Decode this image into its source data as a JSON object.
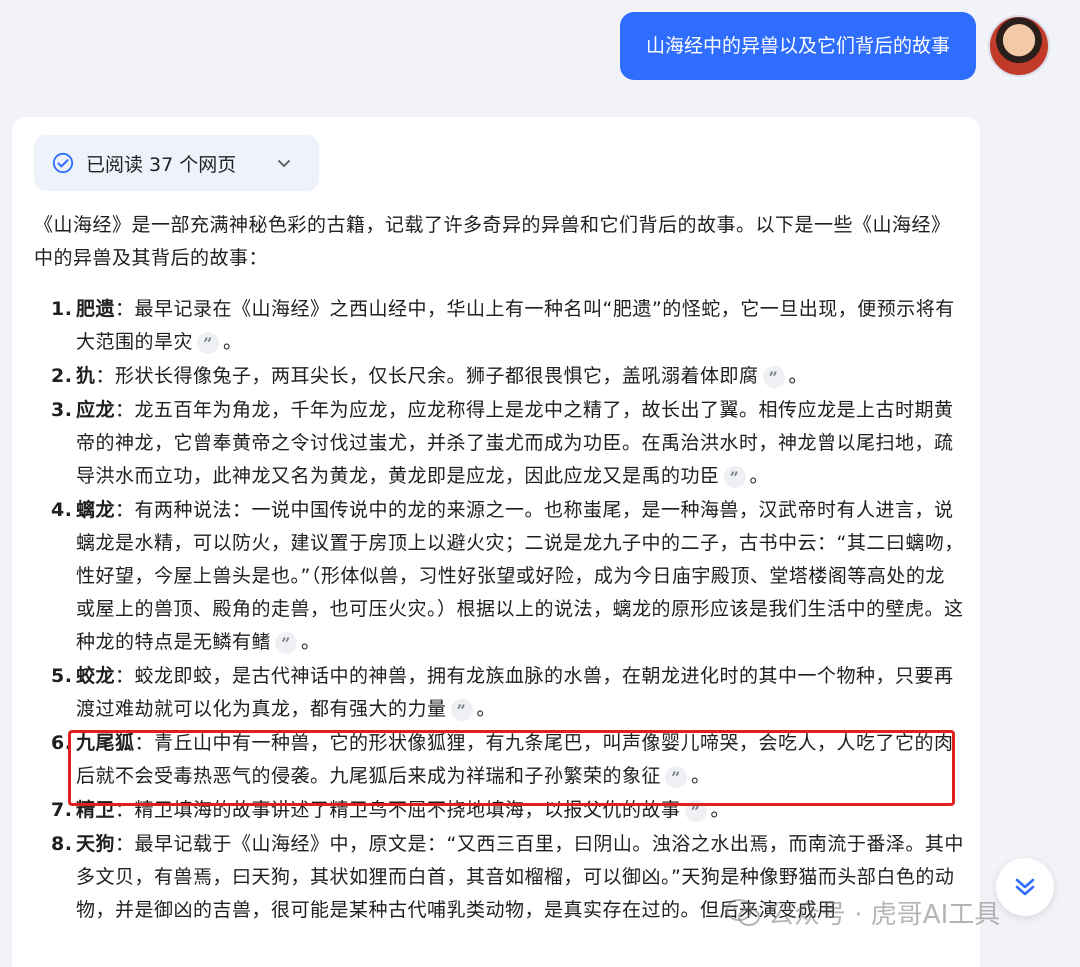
{
  "user": {
    "message": "山海经中的异兽以及它们背后的故事"
  },
  "sources": {
    "label": "已阅读 37 个网页"
  },
  "answer": {
    "intro": "《山海经》是一部充满神秘色彩的古籍，记载了许多奇异的异兽和它们背后的故事。以下是一些《山海经》中的异兽及其背后的故事：",
    "items": [
      {
        "num": "1.",
        "term": "肥遗",
        "text": "：最早记录在《山海经》之西山经中，华山上有一种名叫“肥遗”的怪蛇，它一旦出现，便预示将有大范围的旱灾",
        "end": "。"
      },
      {
        "num": "2.",
        "term": "犰",
        "text": "：形状长得像兔子，两耳尖长，仅长尺余。狮子都很畏惧它，盖吼溺着体即腐",
        "end": "。"
      },
      {
        "num": "3.",
        "term": "应龙",
        "text": "：龙五百年为角龙，千年为应龙，应龙称得上是龙中之精了，故长出了翼。相传应龙是上古时期黄帝的神龙，它曾奉黄帝之令讨伐过蚩尤，并杀了蚩尤而成为功臣。在禹治洪水时，神龙曾以尾扫地，疏导洪水而立功，此神龙又名为黄龙，黄龙即是应龙，因此应龙又是禹的功臣",
        "end": "。"
      },
      {
        "num": "4.",
        "term": "螭龙",
        "text": "：有两种说法：一说中国传说中的龙的来源之一。也称蚩尾，是一种海兽，汉武帝时有人进言，说螭龙是水精，可以防火，建议置于房顶上以避火灾；二说是龙九子中的二子，古书中云：“其二曰螭吻，性好望，今屋上兽头是也。”（形体似兽，习性好张望或好险，成为今日庙宇殿顶、堂塔楼阁等高处的龙或屋上的兽顶、殿角的走兽，也可压火灾。）根据以上的说法，螭龙的原形应该是我们生活中的壁虎。这种龙的特点是无鳞有鳍",
        "end": "。"
      },
      {
        "num": "5.",
        "term": "蛟龙",
        "text": "：蛟龙即蛟，是古代神话中的神兽，拥有龙族血脉的水兽，在朝龙进化时的其中一个物种，只要再渡过难劫就可以化为真龙，都有强大的力量",
        "end": "。"
      },
      {
        "num": "6.",
        "term": "九尾狐",
        "text": "：青丘山中有一种兽，它的形状像狐狸，有九条尾巴，叫声像婴儿啼哭，会吃人，人吃了它的肉后就不会受毒热恶气的侵袭。九尾狐后来成为祥瑞和子孙繁荣的象征",
        "end": "。"
      },
      {
        "num": "7.",
        "term": "精卫",
        "text": "：精卫填海的故事讲述了精卫鸟不屈不挠地填海，以报父仇的故事",
        "end": "。"
      },
      {
        "num": "8.",
        "term": "天狗",
        "text": "：最早记载于《山海经》中，原文是：“又西三百里，曰阴山。浊浴之水出焉，而南流于番泽。其中多文贝，有兽焉，曰天狗，其状如狸而白首，其音如榴榴，可以御凶。”天狗是种像野猫而头部白色的动物，并是御凶的吉兽，很可能是某种古代哺乳类动物，是真实存在过的。但后来演变成用",
        "end": ""
      }
    ],
    "citation_glyph": "”"
  },
  "watermark": {
    "text": "公众号 · 虎哥AI工具"
  },
  "colors": {
    "accent": "#2f6dff",
    "highlight": "#e02020"
  }
}
